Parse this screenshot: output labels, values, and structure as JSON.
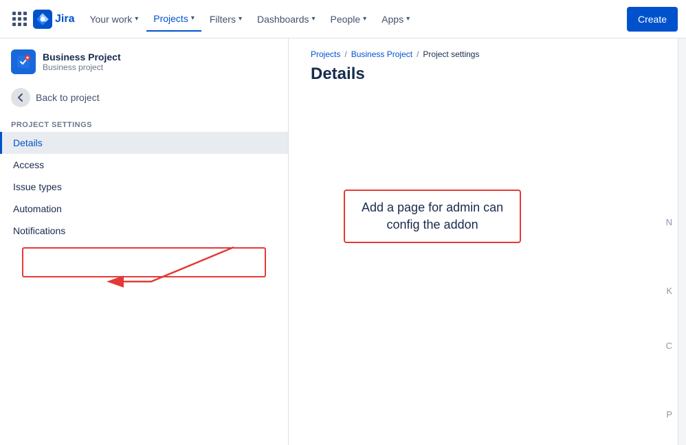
{
  "topnav": {
    "logo_text": "Jira",
    "items": [
      {
        "label": "Your work",
        "has_chevron": true,
        "active": false
      },
      {
        "label": "Projects",
        "has_chevron": true,
        "active": true
      },
      {
        "label": "Filters",
        "has_chevron": true,
        "active": false
      },
      {
        "label": "Dashboards",
        "has_chevron": true,
        "active": false
      },
      {
        "label": "People",
        "has_chevron": true,
        "active": false
      },
      {
        "label": "Apps",
        "has_chevron": true,
        "active": false
      }
    ],
    "create_label": "Create"
  },
  "sidebar": {
    "project_name": "Business Project",
    "project_type": "Business project",
    "back_label": "Back to project",
    "section_label": "Project settings",
    "nav_items": [
      {
        "label": "Details",
        "active": true
      },
      {
        "label": "Access",
        "active": false
      },
      {
        "label": "Issue types",
        "active": false
      },
      {
        "label": "Automation",
        "active": false
      },
      {
        "label": "Notifications",
        "active": false
      }
    ]
  },
  "breadcrumb": {
    "items": [
      "Projects",
      "Business Project",
      "Project settings"
    ]
  },
  "main": {
    "page_title": "Details"
  },
  "annotation": {
    "text_line1": "Add a page for admin can",
    "text_line2": "config the addon"
  }
}
